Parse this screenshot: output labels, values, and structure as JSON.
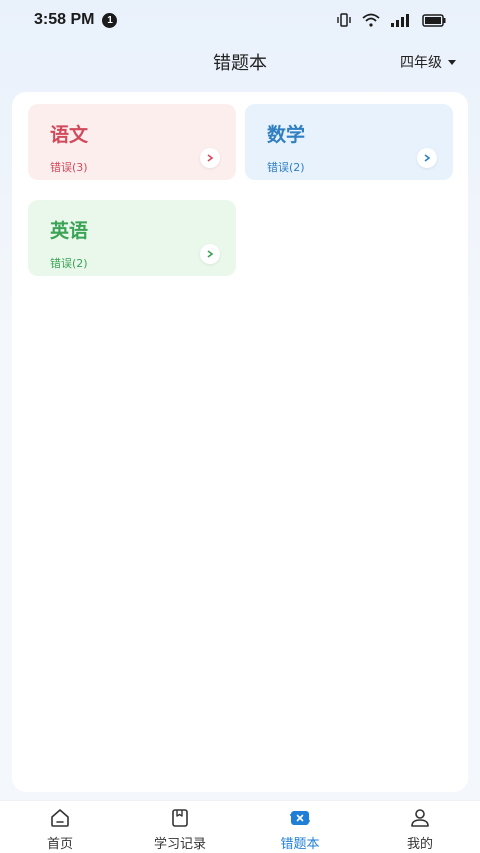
{
  "status_bar": {
    "time": "3:58 PM",
    "notification_count": "1",
    "icons": [
      "vibrate-icon",
      "wifi-icon",
      "signal-icon",
      "battery-icon"
    ]
  },
  "header": {
    "title": "错题本",
    "grade": "四年级"
  },
  "subjects": [
    {
      "name": "语文",
      "errors": "错误(3)",
      "color": "#d14a5c"
    },
    {
      "name": "数学",
      "errors": "错误(2)",
      "color": "#2f7fc1"
    },
    {
      "name": "英语",
      "errors": "错误(2)",
      "color": "#3aa356"
    }
  ],
  "bottom_nav": {
    "items": [
      {
        "label": "首页",
        "icon": "home-icon"
      },
      {
        "label": "学习记录",
        "icon": "book-icon"
      },
      {
        "label": "错题本",
        "icon": "notebook-icon",
        "active": true
      },
      {
        "label": "我的",
        "icon": "user-icon"
      }
    ],
    "active_color": "#1f7fd6"
  }
}
